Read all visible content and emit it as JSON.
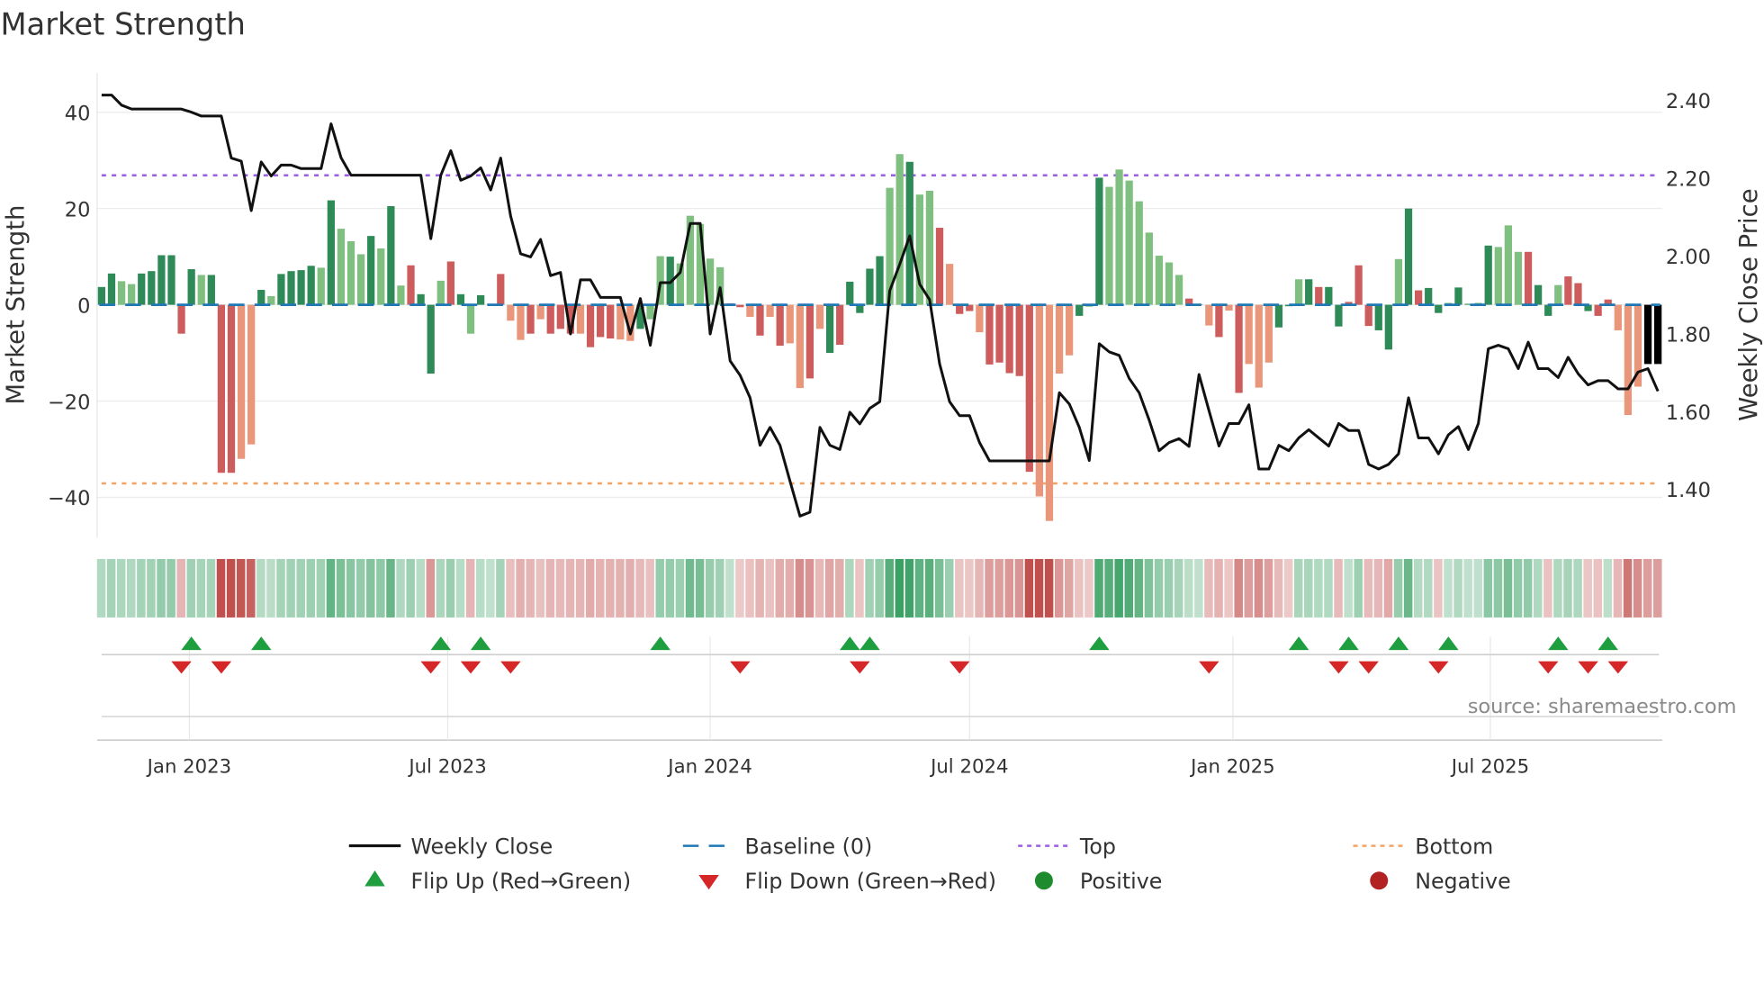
{
  "chart_data": {
    "type": "bar+line",
    "title": "Market Strength",
    "ylabel_left": "Market Strength",
    "ylabel_right": "Weekly Close Price",
    "x_unit": "week index",
    "ylim_left": [
      -48.4,
      48.1
    ],
    "ylim_right": [
      1.276,
      2.469
    ],
    "left_ticks": [
      40,
      20,
      0,
      -20,
      -40
    ],
    "left_tick_labels": [
      "40",
      "20",
      "0",
      "−20",
      "−40"
    ],
    "right_ticks": [
      2.4,
      2.2,
      2.0,
      1.8,
      1.6,
      1.4
    ],
    "right_tick_labels": [
      "2.40",
      "2.20",
      "2.00",
      "1.80",
      "1.60",
      "1.40"
    ],
    "x_ticks": [
      8.8,
      34.7,
      61.0,
      87.0,
      113.4,
      139.2
    ],
    "x_tick_labels": [
      "Jan 2023",
      "Jul 2023",
      "Jan 2024",
      "Jul 2024",
      "Jan 2025",
      "Jul 2025"
    ],
    "top_level": 26.9,
    "bottom_level": -37.1,
    "baseline": 0,
    "strength": [
      3.7,
      6.5,
      4.9,
      4.3,
      6.5,
      7,
      10.3,
      10.3,
      -6,
      7.4,
      6.2,
      6.2,
      -34.9,
      -34.9,
      -32,
      -29,
      3.1,
      1.8,
      6.4,
      7,
      7.2,
      8.1,
      7.7,
      21.7,
      15.8,
      13.2,
      10.5,
      14.3,
      11.7,
      20.5,
      4,
      8.2,
      2.2,
      -14.3,
      5,
      9,
      2.2,
      -6,
      2,
      0.2,
      6.4,
      -3.3,
      -7.3,
      -6,
      -3,
      -6,
      -5,
      -6,
      -6,
      -8.8,
      -6.7,
      -7,
      -7.2,
      -7.5,
      -5,
      -3,
      10.1,
      10,
      8.6,
      18.5,
      16.8,
      9.6,
      7.8,
      0.3,
      -0.5,
      -2.5,
      -6.4,
      -2.5,
      -8.5,
      -8,
      -17.3,
      -15.3,
      -5,
      -10,
      -8.3,
      4.8,
      -1.7,
      7.5,
      10.1,
      24.3,
      31.3,
      29.7,
      22.9,
      23.7,
      16,
      8.5,
      -1.9,
      -1.3,
      -5.7,
      -12.4,
      -12,
      -14.2,
      -14.8,
      -34.7,
      -39.8,
      -44.9,
      -14.3,
      -10.5,
      -2.3,
      -0.4,
      26.4,
      24.5,
      28.1,
      25.8,
      21.5,
      15,
      10.2,
      8.8,
      6.2,
      1.3,
      0.1,
      -4.3,
      -6.7,
      -1.2,
      -18.3,
      -12.3,
      -17.2,
      -12,
      -4.7,
      -0.3,
      5.3,
      5.3,
      3.7,
      3.7,
      -4.5,
      0.6,
      8.2,
      -4.4,
      -5.3,
      -9.3,
      9.5,
      20,
      3,
      3.5,
      -1.7,
      0.4,
      3.6,
      0.2,
      0.4,
      12.3,
      12,
      16.5,
      11,
      11,
      4.1,
      -2.3,
      4.1,
      5.9,
      4.5,
      -1.3,
      -2.3,
      1.1,
      -5.3,
      -22.9,
      -17,
      -12.3,
      -12.3
    ],
    "shade": "GGggGGGGRGgGRRrrGgGGGGgGgggGgGgRGGgRGgGRRrrRrRRRrRRRrrGggGgggggRRrRrRrrRrGRGGGGggGggRrRRrRRRRRrrrrGgGggggggggRRrRrRrrrGGgGRGGRRRGGgGRGGgGGgGgggRGGgRRGRRrrr",
    "close": [
      2.413,
      2.413,
      2.387,
      2.377,
      2.377,
      2.377,
      2.377,
      2.377,
      2.377,
      2.369,
      2.359,
      2.359,
      2.359,
      2.251,
      2.243,
      2.116,
      2.241,
      2.205,
      2.233,
      2.233,
      2.224,
      2.224,
      2.224,
      2.339,
      2.252,
      2.207,
      2.207,
      2.207,
      2.207,
      2.207,
      2.207,
      2.207,
      2.207,
      2.044,
      2.207,
      2.27,
      2.194,
      2.205,
      2.226,
      2.169,
      2.251,
      2.102,
      2.005,
      1.997,
      2.042,
      1.949,
      1.957,
      1.799,
      1.938,
      1.938,
      1.893,
      1.893,
      1.893,
      1.799,
      1.89,
      1.77,
      1.931,
      1.931,
      1.957,
      2.083,
      2.083,
      1.799,
      1.918,
      1.73,
      1.693,
      1.635,
      1.513,
      1.559,
      1.513,
      1.421,
      1.331,
      1.341,
      1.559,
      1.513,
      1.502,
      1.598,
      1.568,
      1.608,
      1.625,
      1.91,
      1.978,
      2.051,
      1.927,
      1.887,
      1.722,
      1.625,
      1.589,
      1.589,
      1.52,
      1.473,
      1.473,
      1.473,
      1.473,
      1.473,
      1.473,
      1.473,
      1.648,
      1.619,
      1.559,
      1.474,
      1.774,
      1.753,
      1.744,
      1.685,
      1.648,
      1.578,
      1.499,
      1.52,
      1.53,
      1.51,
      1.695,
      1.602,
      1.511,
      1.569,
      1.569,
      1.617,
      1.452,
      1.452,
      1.513,
      1.499,
      1.532,
      1.553,
      1.532,
      1.511,
      1.569,
      1.551,
      1.551,
      1.464,
      1.452,
      1.464,
      1.491,
      1.635,
      1.532,
      1.532,
      1.491,
      1.54,
      1.561,
      1.502,
      1.569,
      1.761,
      1.77,
      1.761,
      1.71,
      1.778,
      1.71,
      1.71,
      1.687,
      1.739,
      1.697,
      1.668,
      1.679,
      1.679,
      1.658,
      1.658,
      1.701,
      1.71,
      1.652
    ],
    "flips_up": [
      9,
      16,
      34,
      38,
      56,
      75,
      77,
      100,
      120,
      125,
      130,
      135,
      146,
      151
    ],
    "flips_down": [
      8,
      12,
      33,
      37,
      41,
      64,
      76,
      86,
      111,
      124,
      127,
      134,
      145,
      149,
      152
    ],
    "source": "source: sharemaestro.com",
    "legend": [
      {
        "label": "Weekly Close",
        "icon": "solid-line",
        "color": "#111111"
      },
      {
        "label": "Baseline (0)",
        "icon": "dashed-line",
        "color": "#1f77b4"
      },
      {
        "label": "Top",
        "icon": "dotted-line",
        "color": "#9b5de5"
      },
      {
        "label": "Bottom",
        "icon": "dotted-line",
        "color": "#f4a261"
      },
      {
        "label": "Flip Up (Red→Green)",
        "icon": "triangle-up",
        "color": "#1e9e3e"
      },
      {
        "label": "Flip Down (Green→Red)",
        "icon": "triangle-down",
        "color": "#d62728"
      },
      {
        "label": "Positive",
        "icon": "circle",
        "color": "#1e8c2e"
      },
      {
        "label": "Negative",
        "icon": "circle",
        "color": "#b22222"
      }
    ],
    "colors": {
      "strong_pos": "#2e8b57",
      "weak_pos": "#7fbf7f",
      "strong_neg": "#cd5c5c",
      "weak_neg": "#e9967a",
      "line": "#111111"
    }
  }
}
